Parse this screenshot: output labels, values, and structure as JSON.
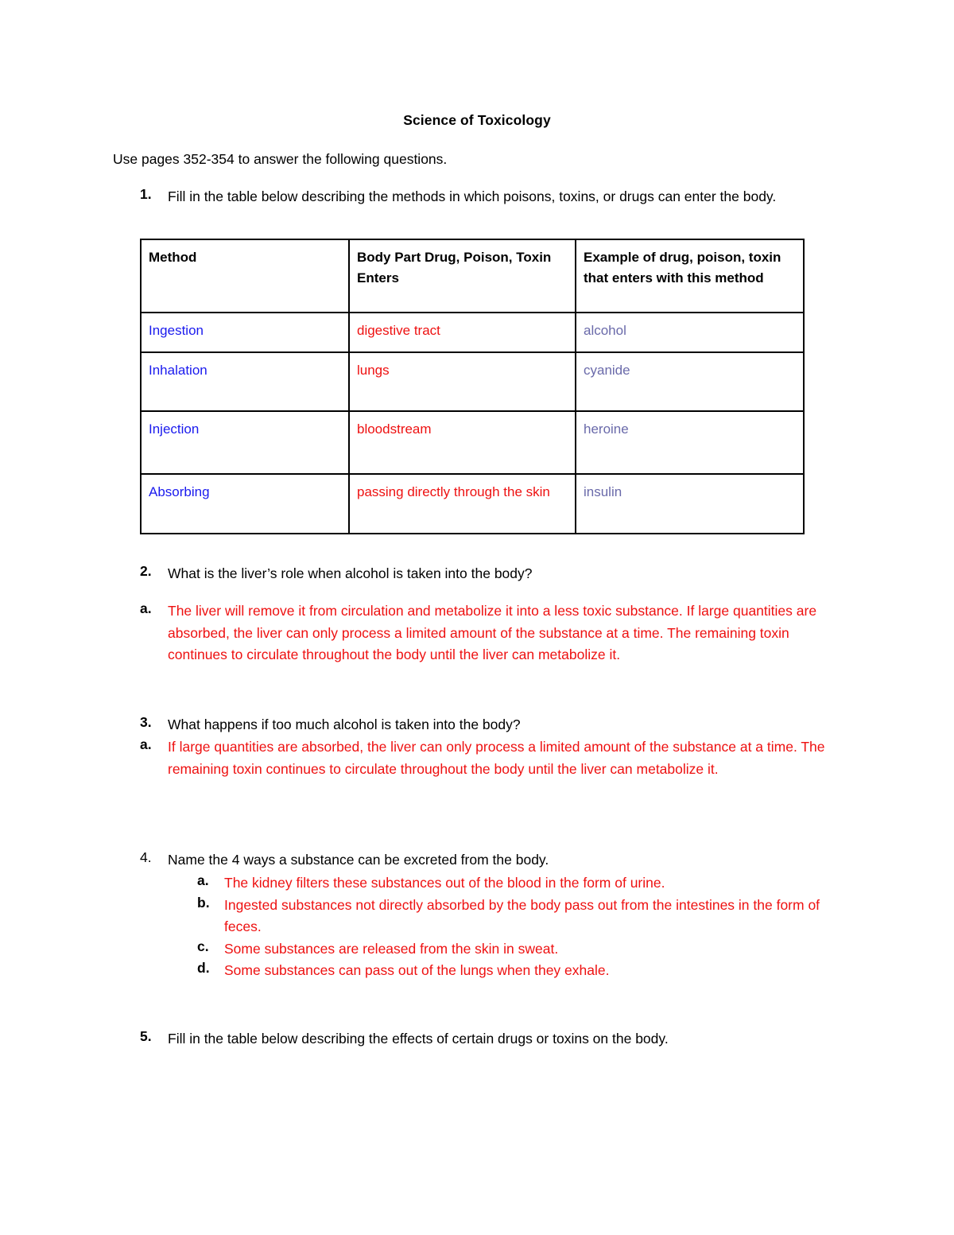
{
  "document": {
    "title": "Science of Toxicology",
    "intro": "Use pages 352-354 to answer the following questions."
  },
  "colors": {
    "method_blue": "#1a1aee",
    "answer_red": "#ee1111",
    "example_slate": "#6a6aaa",
    "text_black": "#000000"
  },
  "questions": {
    "q1": {
      "marker": "1.",
      "text": "Fill in the table below describing the methods in which poisons, toxins, or drugs can enter the body."
    },
    "q2": {
      "marker": "2.",
      "text": "What is the liver’s role when alcohol is taken into the body?",
      "answer_marker": "a.",
      "answer": "The liver will remove it from circulation and metabolize it into a less toxic substance. If large quantities are absorbed, the liver can only process a limited amount of the substance at a time. The remaining toxin continues to circulate throughout the body until the liver can metabolize it."
    },
    "q3": {
      "marker": "3.",
      "text": "What happens if too much alcohol is taken into the body?",
      "answer_marker": "a.",
      "answer": "If large quantities are absorbed, the liver can only process a limited amount of the substance at a time. The remaining toxin continues to circulate throughout the body until the liver can metabolize it."
    },
    "q4": {
      "marker": "4.",
      "text": "Name the 4 ways a substance can be excreted from the body.",
      "answers": [
        {
          "marker": "a.",
          "text": "The kidney filters these substances out of the blood in the form of urine."
        },
        {
          "marker": "b.",
          "text": "Ingested substances not directly absorbed by the body pass out from the intestines in the form of feces."
        },
        {
          "marker": "c.",
          "text": "Some substances are released from the skin in sweat."
        },
        {
          "marker": "d.",
          "text": "Some substances can pass out of the lungs when they exhale."
        }
      ]
    },
    "q5": {
      "marker": "5.",
      "text": "Fill in the table below describing the effects of certain drugs or toxins on the body."
    }
  },
  "methods_table": {
    "headers": [
      "Method",
      "Body Part Drug, Poison, Toxin  Enters",
      "Example of drug, poison, toxin that enters with this method"
    ],
    "rows": [
      {
        "method": "Ingestion",
        "body_part": "digestive tract",
        "example": "alcohol"
      },
      {
        "method": "Inhalation",
        "body_part": "lungs",
        "example": "cyanide"
      },
      {
        "method": "Injection",
        "body_part": "bloodstream",
        "example": "heroine"
      },
      {
        "method": "Absorbing",
        "body_part": "passing directly through the skin",
        "example": "insulin"
      }
    ]
  }
}
